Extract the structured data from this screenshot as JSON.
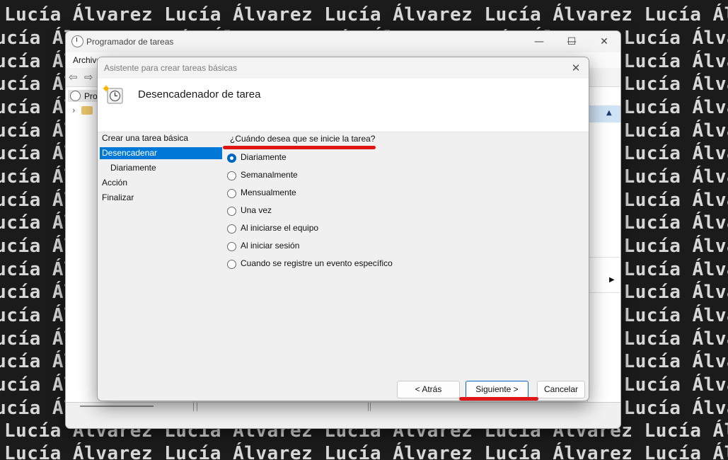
{
  "watermark": {
    "text": "Lucía Álvarez Lucía Álvarez Lucía Álvarez Lucía Álvarez Lucía Álvarez Lucía Álvarez"
  },
  "main_window": {
    "title": "Programador de tareas",
    "menu": "Archivo",
    "tree_item": "Prog",
    "controls": {
      "minimize": "—",
      "maximize": "☐",
      "close": "✕"
    }
  },
  "dialog": {
    "title": "Asistente para crear tareas básicas",
    "close": "✕",
    "header_title": "Desencadenador de tarea",
    "steps": [
      "Crear una tarea básica",
      "Desencadenar",
      "Diariamente",
      "Acción",
      "Finalizar"
    ],
    "active_step": "Desencadenar",
    "question": "¿Cuándo desea que se inicie la tarea?",
    "options": [
      "Diariamente",
      "Semanalmente",
      "Mensualmente",
      "Una vez",
      "Al iniciarse el equipo",
      "Al iniciar sesión",
      "Cuando se registre un evento específico"
    ],
    "selected_option": "Diariamente",
    "buttons": {
      "back": "< Atrás",
      "next": "Siguiente >",
      "cancel": "Cancelar"
    }
  },
  "colors": {
    "accent": "#0078d7",
    "annotation": "#e01616"
  }
}
